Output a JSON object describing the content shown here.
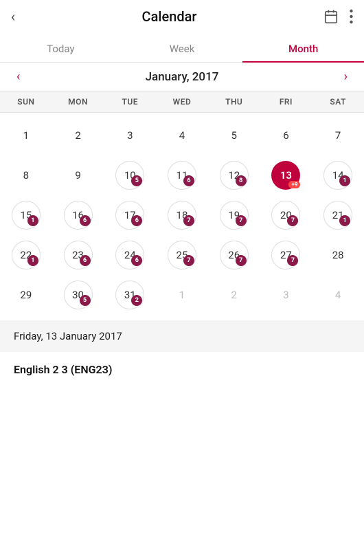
{
  "header": {
    "back_label": "‹",
    "title": "Calendar",
    "calendar_icon": "📅",
    "more_icon": "⋮"
  },
  "tabs": [
    {
      "id": "today",
      "label": "Today",
      "active": false
    },
    {
      "id": "week",
      "label": "Week",
      "active": false
    },
    {
      "id": "month",
      "label": "Month",
      "active": true
    }
  ],
  "month_nav": {
    "prev_arrow": "‹",
    "title": "January, 2017",
    "next_arrow": "›"
  },
  "day_headers": [
    "SUN",
    "MON",
    "TUE",
    "WED",
    "THU",
    "FRI",
    "SAT"
  ],
  "selected_date": "Friday, 13 January 2017",
  "footer_label": "English 2 3 (ENG23)"
}
